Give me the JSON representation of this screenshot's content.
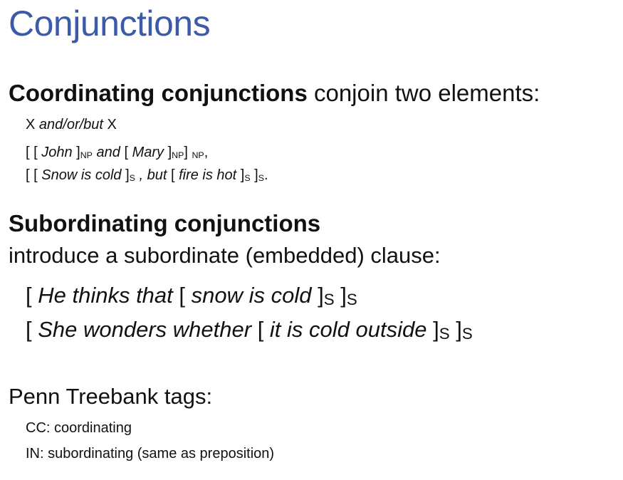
{
  "title": "Conjunctions",
  "coordinating": {
    "heading_bold": "Coordinating conjunctions",
    "heading_rest": " conjoin two elements:",
    "pattern": {
      "x1": "X ",
      "conj": "and/or/but",
      "x2": " X"
    },
    "example1": {
      "open": "[ [ ",
      "word1": "John",
      "close1": " ]",
      "tag1": "NP",
      "conj": " and ",
      "open2": " [ ",
      "word2": "Mary",
      "close2": " ]",
      "tag2": "NP",
      "close3": "] ",
      "tag3": "NP",
      "end": ","
    },
    "example2": {
      "open": "[ [ ",
      "clause1": "Snow is cold",
      "close1": " ]",
      "tag1": "S",
      "conj": " , but ",
      "open2": " [ ",
      "clause2": "fire is hot",
      "close2": " ]",
      "tag2": "S",
      "close3": " ]",
      "tag3": "S",
      "end": "."
    }
  },
  "subordinating": {
    "heading": "Subordinating conjunctions",
    "description": "introduce a subordinate (embedded) clause:",
    "example1": {
      "open": "[ ",
      "main": "He thinks that ",
      "open2": " [ ",
      "clause": "snow is cold",
      "close1": " ]",
      "tag1": "S",
      "close2": " ]",
      "tag2": "S"
    },
    "example2": {
      "open": "[ ",
      "main": "She wonders whether",
      "open2": " [ ",
      "clause": "it is cold outside",
      "close1": " ]",
      "tag1": "S",
      "close2": " ]",
      "tag2": "S"
    }
  },
  "penn": {
    "heading": "Penn Treebank tags:",
    "cc": "CC: coordinating",
    "in": "IN: subordinating (same as preposition)"
  }
}
